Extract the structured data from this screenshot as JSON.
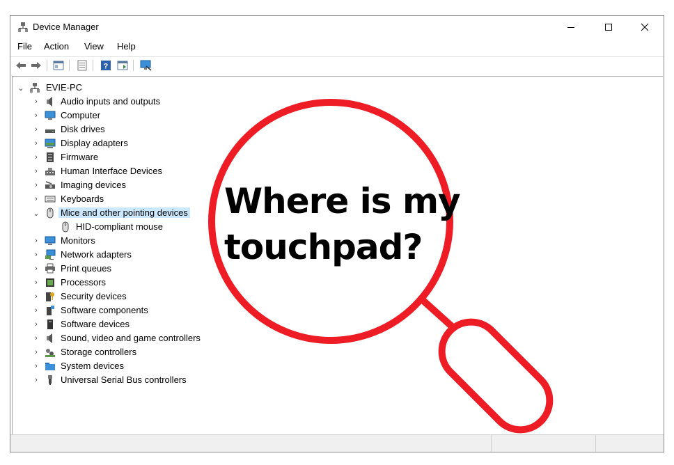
{
  "window": {
    "title": "Device Manager",
    "controls": {
      "minimize": "—",
      "maximize": "☐",
      "close": "✕"
    }
  },
  "menu": [
    "File",
    "Action",
    "View",
    "Help"
  ],
  "toolbar": {
    "icons": [
      "back-icon",
      "forward-icon",
      "properties-icon",
      "show-hide-console-tree-icon",
      "help-icon",
      "run-action-icon",
      "scan-hardware-icon"
    ]
  },
  "tree": {
    "root": {
      "label": "EVIE-PC",
      "expanded": true
    },
    "categories": [
      {
        "label": "Audio inputs and outputs",
        "icon": "speaker-icon",
        "expanded": false
      },
      {
        "label": "Computer",
        "icon": "computer-icon",
        "expanded": false
      },
      {
        "label": "Disk drives",
        "icon": "disk-icon",
        "expanded": false
      },
      {
        "label": "Display adapters",
        "icon": "display-adapter-icon",
        "expanded": false
      },
      {
        "label": "Firmware",
        "icon": "firmware-icon",
        "expanded": false
      },
      {
        "label": "Human Interface Devices",
        "icon": "hid-icon",
        "expanded": false
      },
      {
        "label": "Imaging devices",
        "icon": "camera-icon",
        "expanded": false
      },
      {
        "label": "Keyboards",
        "icon": "keyboard-icon",
        "expanded": false
      },
      {
        "label": "Mice and other pointing devices",
        "icon": "mouse-icon",
        "expanded": true,
        "selected": true,
        "children": [
          {
            "label": "HID-compliant mouse",
            "icon": "mouse-icon"
          }
        ]
      },
      {
        "label": "Monitors",
        "icon": "monitor-icon",
        "expanded": false
      },
      {
        "label": "Network adapters",
        "icon": "network-icon",
        "expanded": false
      },
      {
        "label": "Print queues",
        "icon": "printer-icon",
        "expanded": false
      },
      {
        "label": "Processors",
        "icon": "processor-icon",
        "expanded": false
      },
      {
        "label": "Security devices",
        "icon": "security-key-icon",
        "expanded": false
      },
      {
        "label": "Software components",
        "icon": "software-component-icon",
        "expanded": false
      },
      {
        "label": "Software devices",
        "icon": "software-device-icon",
        "expanded": false
      },
      {
        "label": "Sound, video and game controllers",
        "icon": "speaker-icon",
        "expanded": false
      },
      {
        "label": "Storage controllers",
        "icon": "storage-controller-icon",
        "expanded": false
      },
      {
        "label": "System devices",
        "icon": "folder-icon",
        "expanded": false
      },
      {
        "label": "Universal Serial Bus controllers",
        "icon": "usb-icon",
        "expanded": false
      }
    ]
  },
  "callout": {
    "line1": "Where is my",
    "line2": "touchpad?",
    "ring_color": "#ee1c24"
  },
  "colors": {
    "selection": "#cce8ff",
    "accent": "#0078d7"
  }
}
